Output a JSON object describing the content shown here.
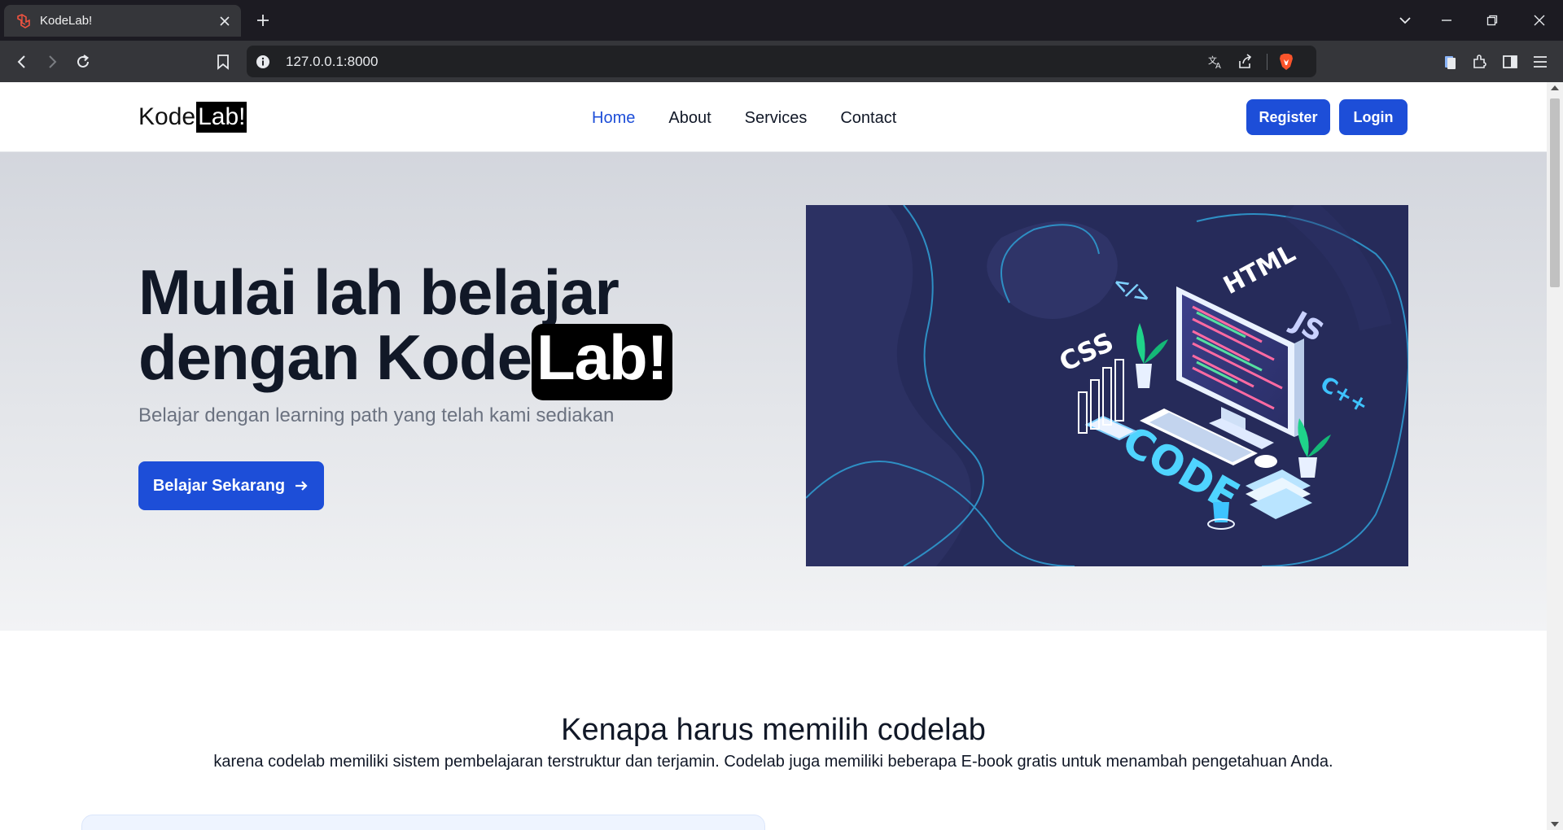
{
  "browser": {
    "tab_title": "KodeLab!",
    "url": "127.0.0.1:8000"
  },
  "site": {
    "logo_kode": "Kode",
    "logo_lab": "Lab!",
    "nav": {
      "links": [
        "Home",
        "About",
        "Services",
        "Contact"
      ],
      "active": "Home"
    },
    "register_label": "Register",
    "login_label": "Login",
    "brand_color": "#1d4ed8"
  },
  "hero": {
    "title_line1": "Mulai lah belajar",
    "title_line2_prefix": "dengan Kode",
    "title_line2_highlight": "Lab!",
    "subtitle": "Belajar dengan learning path yang telah kami sediakan",
    "cta_label": "Belajar Sekarang",
    "illustration": {
      "labels": [
        "</>",
        "HTML",
        "CSS",
        "JS",
        "C++",
        "CODE"
      ]
    }
  },
  "why": {
    "title": "Kenapa harus memilih codelab",
    "description": "karena codelab memiliki sistem pembelajaran terstruktur dan terjamin. Codelab juga memiliki beberapa E-book gratis untuk menambah pengetahuan Anda."
  }
}
